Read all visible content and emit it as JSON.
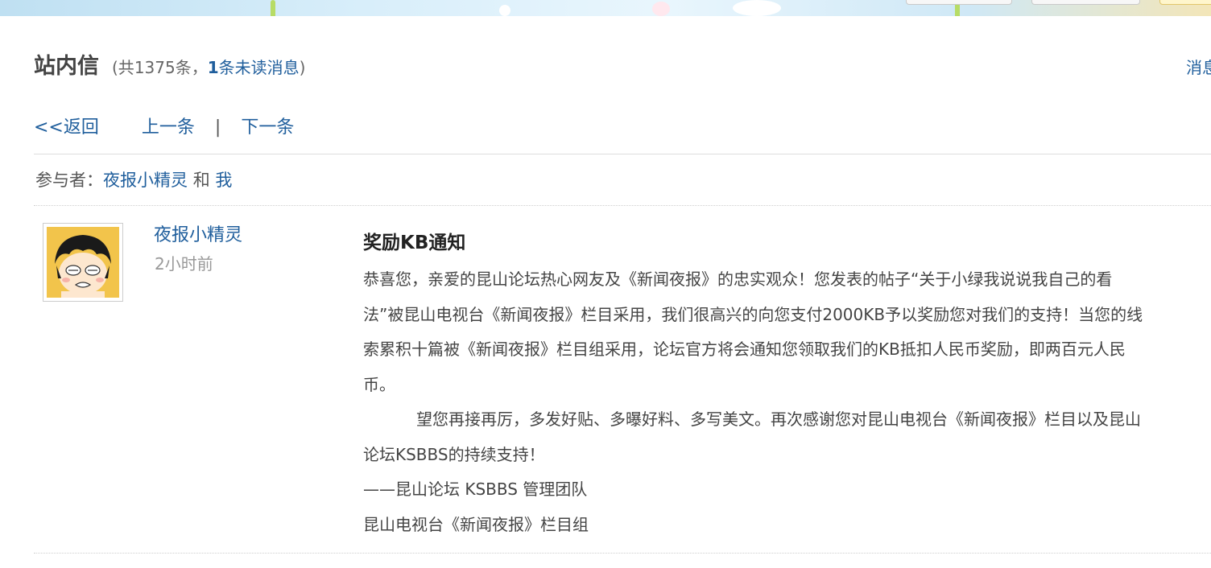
{
  "header": {
    "title": "站内信",
    "count_prefix": "(共",
    "total": "1375",
    "count_mid": "条，",
    "unread_count": "1",
    "unread_suffix": "条未读消息",
    "count_close": ")",
    "top_right_link": "消息"
  },
  "nav": {
    "back": "<<返回",
    "prev": "上一条",
    "separator": "|",
    "next": "下一条"
  },
  "participants": {
    "label": "参与者：",
    "user1": "夜报小精灵",
    "and": "和",
    "user2": "我"
  },
  "message": {
    "sender": "夜报小精灵",
    "time": "2小时前",
    "title": "奖励KB通知",
    "paragraph1": "恭喜您，亲爱的昆山论坛热心网友及《新闻夜报》的忠实观众！您发表的帖子“关于小绿我说说我自己的看法”被昆山电视台《新闻夜报》栏目采用，我们很高兴的向您支付2000KB予以奖励您对我们的支持！当您的线索累积十篇被《新闻夜报》栏目组采用，论坛官方将会通知您领取我们的KB抵扣人民币奖励，即两百元人民币。",
    "paragraph2": "望您再接再厉，多发好贴、多曝好料、多写美文。再次感谢您对昆山电视台《新闻夜报》栏目以及昆山论坛KSBBS的持续支持！",
    "signature1": "——昆山论坛 KSBBS 管理团队",
    "signature2": "昆山电视台《新闻夜报》栏目组"
  },
  "colors": {
    "link": "#1f5e9c",
    "text": "#444444",
    "muted": "#999999"
  },
  "icons": {
    "avatar": "cartoon-girl-avatar"
  }
}
